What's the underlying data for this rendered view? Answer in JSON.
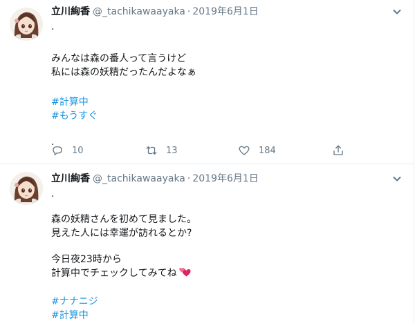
{
  "colors": {
    "text": "#14171a",
    "muted": "#657786",
    "link": "#1b95e0",
    "border": "#e6ecf0",
    "heart": "#e0245e"
  },
  "tweets": [
    {
      "user": {
        "display_name": "立川絢香",
        "handle": "@_tachikawaayaka",
        "avatar_icon": "avatar-anime-girl"
      },
      "separator": "·",
      "date": "2019年6月1日",
      "lines": [
        ".",
        "",
        " みんなは森の番人って言うけど",
        " 私には森の妖精だったんだよなぁ",
        "",
        "#計算中",
        "#もうすぐ",
        "",
        "."
      ],
      "stats": {
        "replies": "10",
        "retweets": "13",
        "likes": "184"
      }
    },
    {
      "user": {
        "display_name": "立川絢香",
        "handle": "@_tachikawaayaka",
        "avatar_icon": "avatar-anime-girl"
      },
      "separator": "·",
      "date": "2019年6月1日",
      "lines": [
        ".",
        "",
        " 森の妖精さんを初めて見ました。",
        " 見えた人には幸運が訪れるとか?",
        "",
        " 今日夜23時から",
        " 計算中でチェックしてみてね",
        "",
        "#ナナニジ",
        "#計算中"
      ],
      "inline_emoji": "two-hearts-emoji"
    }
  ]
}
